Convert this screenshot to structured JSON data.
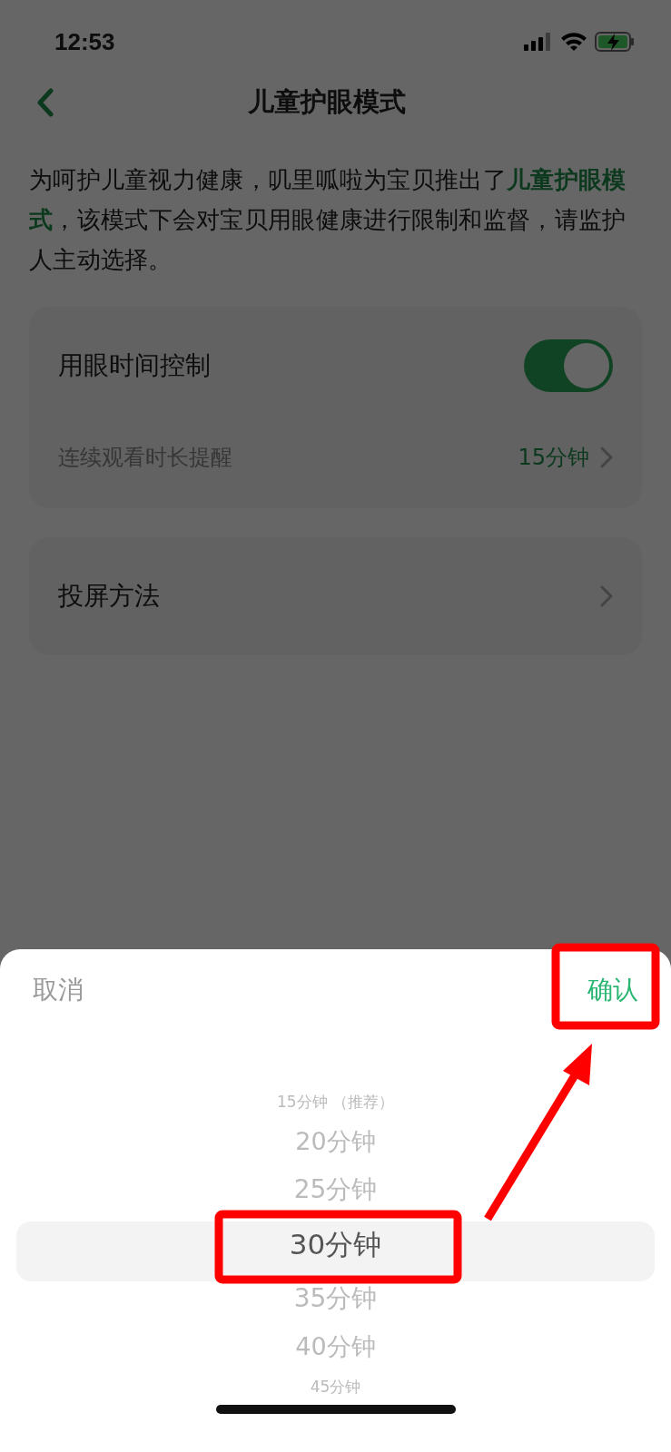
{
  "status_bar": {
    "time": "12:53"
  },
  "nav": {
    "title": "儿童护眼模式"
  },
  "intro": "为呵护儿童视力健康，叽里呱啦为宝贝推出了**儿童护眼模式**，该模式下会对宝贝用眼健康进行限制和监督，请监护人主动选择。",
  "cards": [
    {
      "rows": [
        {
          "kind": "toggle",
          "label": "用眼时间控制",
          "on": true
        },
        {
          "kind": "link",
          "label": "连续观看时长提醒",
          "value": "15分钟"
        }
      ]
    },
    {
      "rows": [
        {
          "kind": "link",
          "label": "投屏方法"
        }
      ]
    }
  ],
  "picker": {
    "cancel": "取消",
    "confirm": "确认",
    "options": [
      {
        "label": "15分钟 （推荐）",
        "selected": false
      },
      {
        "label": "20分钟",
        "selected": false
      },
      {
        "label": "25分钟",
        "selected": false
      },
      {
        "label": "30分钟",
        "selected": true
      },
      {
        "label": "35分钟",
        "selected": false
      },
      {
        "label": "40分钟",
        "selected": false
      },
      {
        "label": "45分钟",
        "selected": false
      }
    ]
  }
}
